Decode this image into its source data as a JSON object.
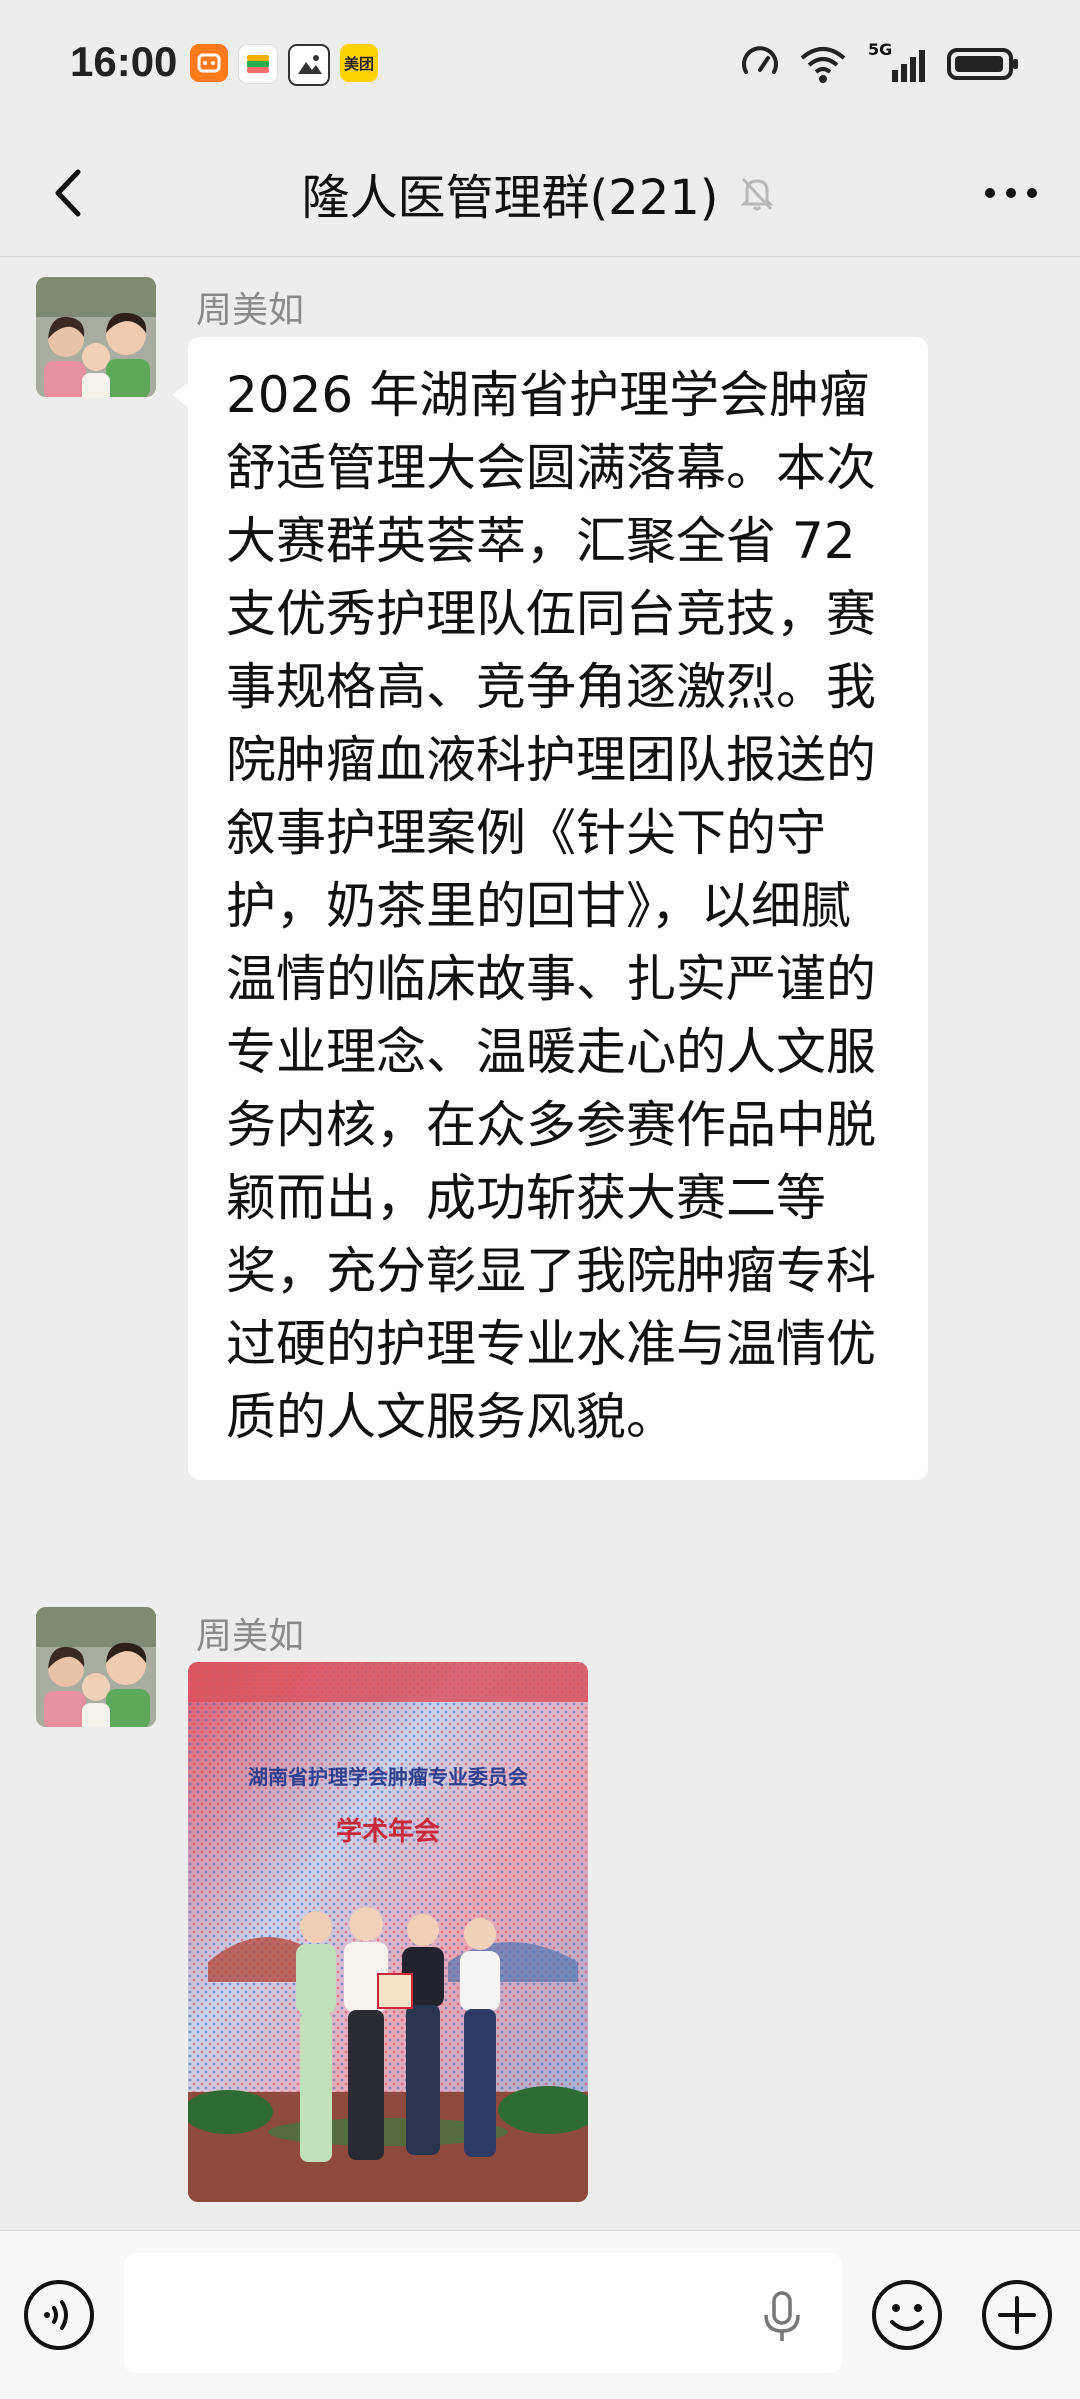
{
  "status_bar": {
    "time": "16:00",
    "notification_icons": [
      "taobao-icon",
      "wallet-icon",
      "photo-icon",
      "meituan-icon"
    ],
    "meituan_label": "美团",
    "network_label": "5G"
  },
  "header": {
    "title": "隆人医管理群(221)",
    "muted": true
  },
  "messages": [
    {
      "sender": "周美如",
      "type": "text",
      "text": "2026 年湖南省护理学会肿瘤舒适管理大会圆满落幕。本次大赛群英荟萃，汇聚全省 72 支优秀护理队伍同台竞技，赛事规格高、竞争角逐激烈。我院肿瘤血液科护理团队报送的叙事护理案例《针尖下的守护，奶茶里的回甘》，以细腻温情的临床故事、扎实严谨的专业理念、温暖走心的人文服务内核，在众多参赛作品中脱颖而出，成功斩获大赛二等奖，充分彰显了我院肿瘤专科过硬的护理专业水准与温情优质的人文服务风貌。"
    },
    {
      "sender": "周美如",
      "type": "image",
      "image_banner_title": "湖南省护理学会肿瘤专业委员会",
      "image_banner_subtitle": "学术年会"
    }
  ],
  "input_bar": {
    "voice_icon": "voice-mode-icon",
    "mic_icon": "microphone-icon",
    "emoji_icon": "emoji-icon",
    "plus_icon": "plus-icon"
  },
  "colors": {
    "background": "#ededed",
    "bubble": "#ffffff",
    "sender_name": "#8a8a8a"
  }
}
